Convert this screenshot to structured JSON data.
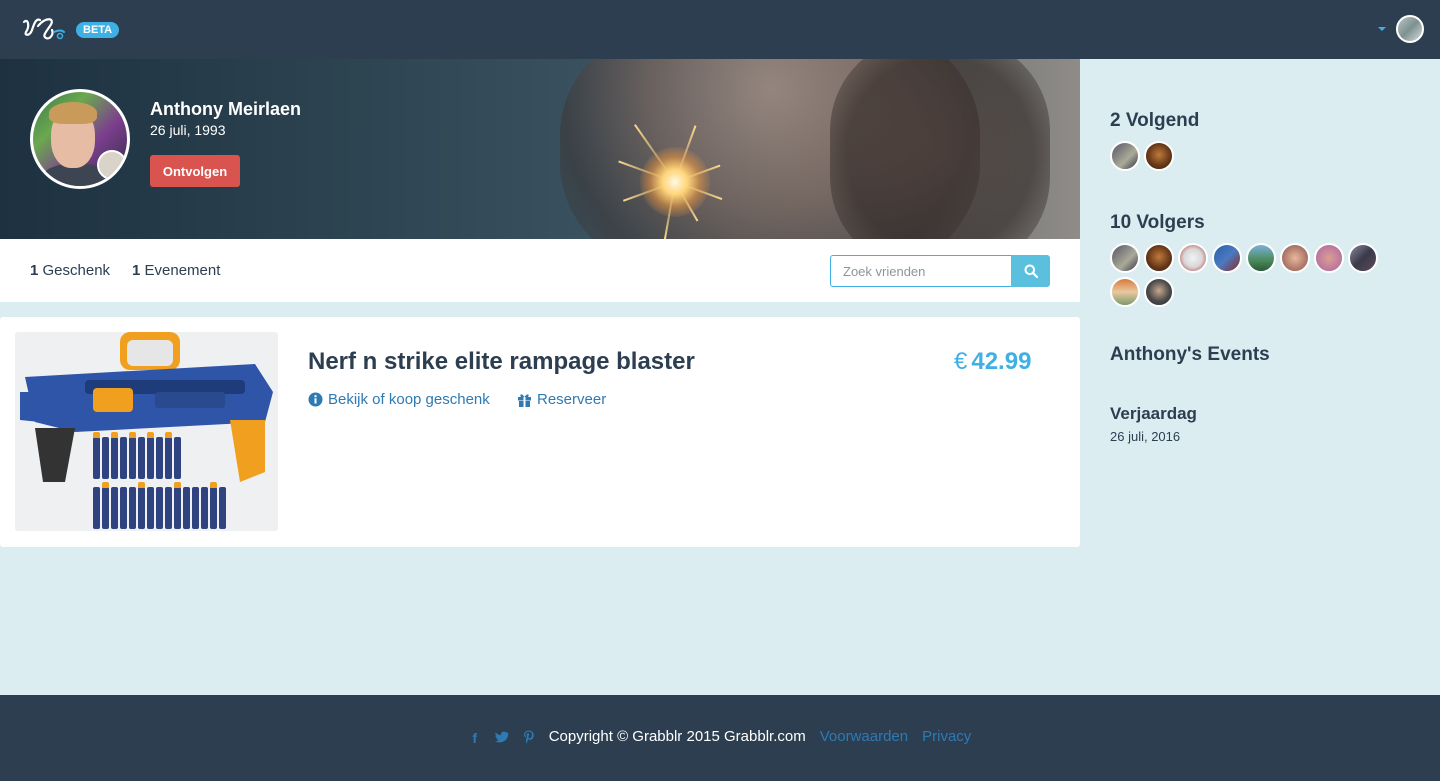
{
  "nav": {
    "beta_label": "BETA",
    "logo_icon": "grabblr-logo-icon",
    "user_menu_icon": "caret-down-icon"
  },
  "profile": {
    "name": "Anthony Meirlaen",
    "birthdate": "26 juli, 1993",
    "unfollow_label": "Ontvolgen"
  },
  "stats": {
    "gifts_count": "1",
    "gifts_label": "Geschenk",
    "events_count": "1",
    "events_label": "Evenement"
  },
  "search": {
    "placeholder": "Zoek vrienden",
    "icon": "search-icon"
  },
  "gift": {
    "title": "Nerf n strike elite rampage blaster",
    "currency": "€",
    "price": "42.99",
    "view_label": "Bekijk of koop geschenk",
    "reserve_label": "Reserveer"
  },
  "sidebar": {
    "following_title": "2 Volgend",
    "followers_title": "10 Volgers",
    "events_title": "Anthony's Events",
    "event_name": "Verjaardag",
    "event_date": "26 juli, 2016"
  },
  "footer": {
    "copyright": "Copyright © Grabblr 2015 Grabblr.com",
    "terms_label": "Voorwaarden",
    "privacy_label": "Privacy",
    "social_icons": [
      "facebook-icon",
      "twitter-icon",
      "pinterest-icon"
    ]
  },
  "colors": {
    "navbar": "#2c3e50",
    "accent": "#3fb0e3",
    "danger": "#d9534f",
    "link": "#2e7ab3",
    "page_bg": "#dcedf2"
  }
}
